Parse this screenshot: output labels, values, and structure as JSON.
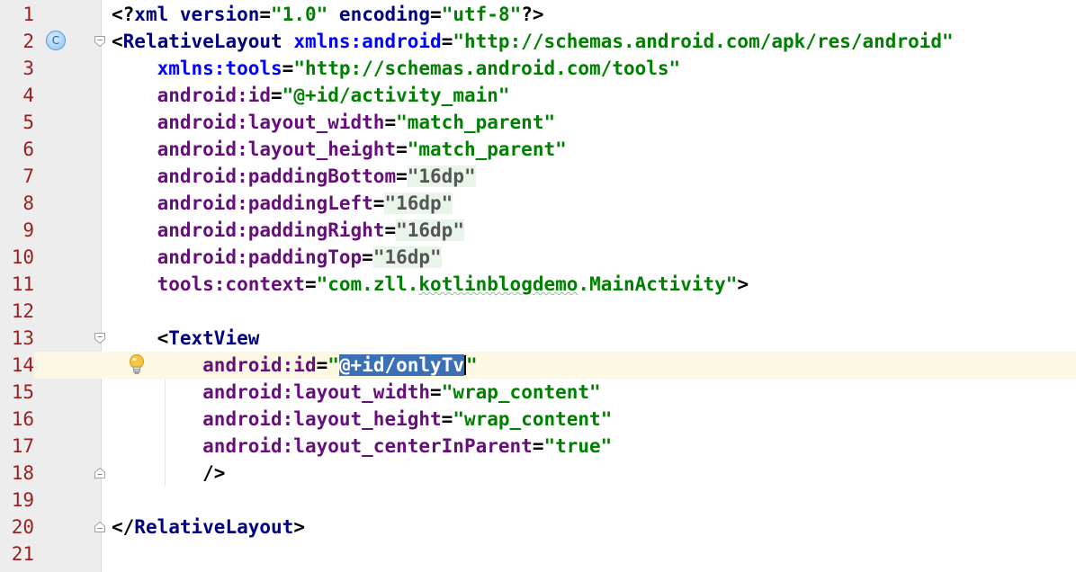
{
  "editor": {
    "lines": [
      {
        "num": "1",
        "segments": [
          {
            "t": "<?",
            "c": "punct"
          },
          {
            "t": "xml ",
            "c": "tag"
          },
          {
            "t": "version",
            "c": "tag"
          },
          {
            "t": "=",
            "c": "punct"
          },
          {
            "t": "\"1.0\"",
            "c": "val"
          },
          {
            "t": " ",
            "c": "punct"
          },
          {
            "t": "encoding",
            "c": "tag"
          },
          {
            "t": "=",
            "c": "punct"
          },
          {
            "t": "\"utf-8\"",
            "c": "val"
          },
          {
            "t": "?>",
            "c": "punct"
          }
        ]
      },
      {
        "num": "2",
        "marker": "C",
        "fold": "open",
        "segments": [
          {
            "t": "<",
            "c": "punct"
          },
          {
            "t": "RelativeLayout",
            "c": "tag"
          },
          {
            "t": " ",
            "c": "punct"
          },
          {
            "t": "xmlns:android",
            "c": "ns"
          },
          {
            "t": "=",
            "c": "punct"
          },
          {
            "t": "\"http://schemas.android.com/apk/res/android\"",
            "c": "val"
          }
        ]
      },
      {
        "num": "3",
        "segments": [
          {
            "t": "    ",
            "c": "punct"
          },
          {
            "t": "xmlns:tools",
            "c": "ns"
          },
          {
            "t": "=",
            "c": "punct"
          },
          {
            "t": "\"http://schemas.android.com/tools\"",
            "c": "val"
          }
        ]
      },
      {
        "num": "4",
        "segments": [
          {
            "t": "    ",
            "c": "punct"
          },
          {
            "t": "android:id",
            "c": "attr"
          },
          {
            "t": "=",
            "c": "punct"
          },
          {
            "t": "\"@+id/activity_main\"",
            "c": "val"
          }
        ]
      },
      {
        "num": "5",
        "segments": [
          {
            "t": "    ",
            "c": "punct"
          },
          {
            "t": "android:layout_width",
            "c": "attr"
          },
          {
            "t": "=",
            "c": "punct"
          },
          {
            "t": "\"match_parent\"",
            "c": "val"
          }
        ]
      },
      {
        "num": "6",
        "segments": [
          {
            "t": "    ",
            "c": "punct"
          },
          {
            "t": "android:layout_height",
            "c": "attr"
          },
          {
            "t": "=",
            "c": "punct"
          },
          {
            "t": "\"match_parent\"",
            "c": "val"
          }
        ]
      },
      {
        "num": "7",
        "segments": [
          {
            "t": "    ",
            "c": "punct"
          },
          {
            "t": "android:paddingBottom",
            "c": "attr"
          },
          {
            "t": "=",
            "c": "punct"
          },
          {
            "t": "\"16dp\"",
            "c": "num"
          }
        ]
      },
      {
        "num": "8",
        "segments": [
          {
            "t": "    ",
            "c": "punct"
          },
          {
            "t": "android:paddingLeft",
            "c": "attr"
          },
          {
            "t": "=",
            "c": "punct"
          },
          {
            "t": "\"16dp\"",
            "c": "num"
          }
        ]
      },
      {
        "num": "9",
        "segments": [
          {
            "t": "    ",
            "c": "punct"
          },
          {
            "t": "android:paddingRight",
            "c": "attr"
          },
          {
            "t": "=",
            "c": "punct"
          },
          {
            "t": "\"16dp\"",
            "c": "num"
          }
        ]
      },
      {
        "num": "10",
        "segments": [
          {
            "t": "    ",
            "c": "punct"
          },
          {
            "t": "android:paddingTop",
            "c": "attr"
          },
          {
            "t": "=",
            "c": "punct"
          },
          {
            "t": "\"16dp\"",
            "c": "num"
          }
        ]
      },
      {
        "num": "11",
        "segments": [
          {
            "t": "    ",
            "c": "punct"
          },
          {
            "t": "tools:context",
            "c": "attr"
          },
          {
            "t": "=",
            "c": "punct"
          },
          {
            "t": "\"com.zll.",
            "c": "val"
          },
          {
            "t": "kotlinblogdemo",
            "c": "val wavy"
          },
          {
            "t": ".MainActivity\"",
            "c": "val"
          },
          {
            "t": ">",
            "c": "punct"
          }
        ]
      },
      {
        "num": "12",
        "segments": []
      },
      {
        "num": "13",
        "fold": "open",
        "segments": [
          {
            "t": "    ",
            "c": "punct"
          },
          {
            "t": "<",
            "c": "punct"
          },
          {
            "t": "TextView",
            "c": "tag"
          }
        ]
      },
      {
        "num": "14",
        "current": true,
        "bulb": true,
        "segments": [
          {
            "t": "        ",
            "c": "punct"
          },
          {
            "t": "android:id",
            "c": "attr"
          },
          {
            "t": "=",
            "c": "punct"
          },
          {
            "t": "\"",
            "c": "val"
          },
          {
            "t": "@+id/onlyTv",
            "c": "sel"
          },
          {
            "t": "",
            "c": "caret"
          },
          {
            "t": "\"",
            "c": "val"
          }
        ]
      },
      {
        "num": "15",
        "segments": [
          {
            "t": "        ",
            "c": "punct"
          },
          {
            "t": "android:layout_width",
            "c": "attr"
          },
          {
            "t": "=",
            "c": "punct"
          },
          {
            "t": "\"wrap_content\"",
            "c": "val"
          }
        ]
      },
      {
        "num": "16",
        "segments": [
          {
            "t": "        ",
            "c": "punct"
          },
          {
            "t": "android:layout_height",
            "c": "attr"
          },
          {
            "t": "=",
            "c": "punct"
          },
          {
            "t": "\"wrap_content\"",
            "c": "val"
          }
        ]
      },
      {
        "num": "17",
        "segments": [
          {
            "t": "        ",
            "c": "punct"
          },
          {
            "t": "android:layout_centerInParent",
            "c": "attr"
          },
          {
            "t": "=",
            "c": "punct"
          },
          {
            "t": "\"true\"",
            "c": "val"
          }
        ]
      },
      {
        "num": "18",
        "fold": "close",
        "segments": [
          {
            "t": "        ",
            "c": "punct"
          },
          {
            "t": "/>",
            "c": "punct"
          }
        ]
      },
      {
        "num": "19",
        "segments": []
      },
      {
        "num": "20",
        "fold": "close",
        "segments": [
          {
            "t": "</",
            "c": "punct"
          },
          {
            "t": "RelativeLayout",
            "c": "tag"
          },
          {
            "t": ">",
            "c": "punct"
          }
        ]
      },
      {
        "num": "21",
        "segments": []
      }
    ],
    "icons": {
      "class_marker": "class-icon",
      "intention": "lightbulb-icon",
      "fold_open": "fold-open-icon",
      "fold_close": "fold-close-icon"
    }
  }
}
